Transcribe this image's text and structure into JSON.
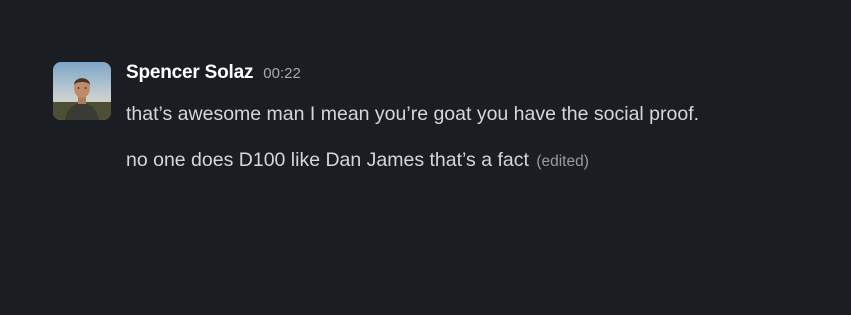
{
  "message": {
    "sender": "Spencer Solaz",
    "timestamp": "00:22",
    "lines": [
      "that’s awesome man I mean you’re goat you have the social proof.",
      "no one does D100 like Dan James that’s a fact"
    ],
    "edited_label": "(edited)",
    "avatar_icon": "user-photo-avatar"
  },
  "colors": {
    "background": "#1a1d21",
    "sender": "#ffffff",
    "text": "#d6d6d8",
    "muted": "#a8a8ab"
  }
}
